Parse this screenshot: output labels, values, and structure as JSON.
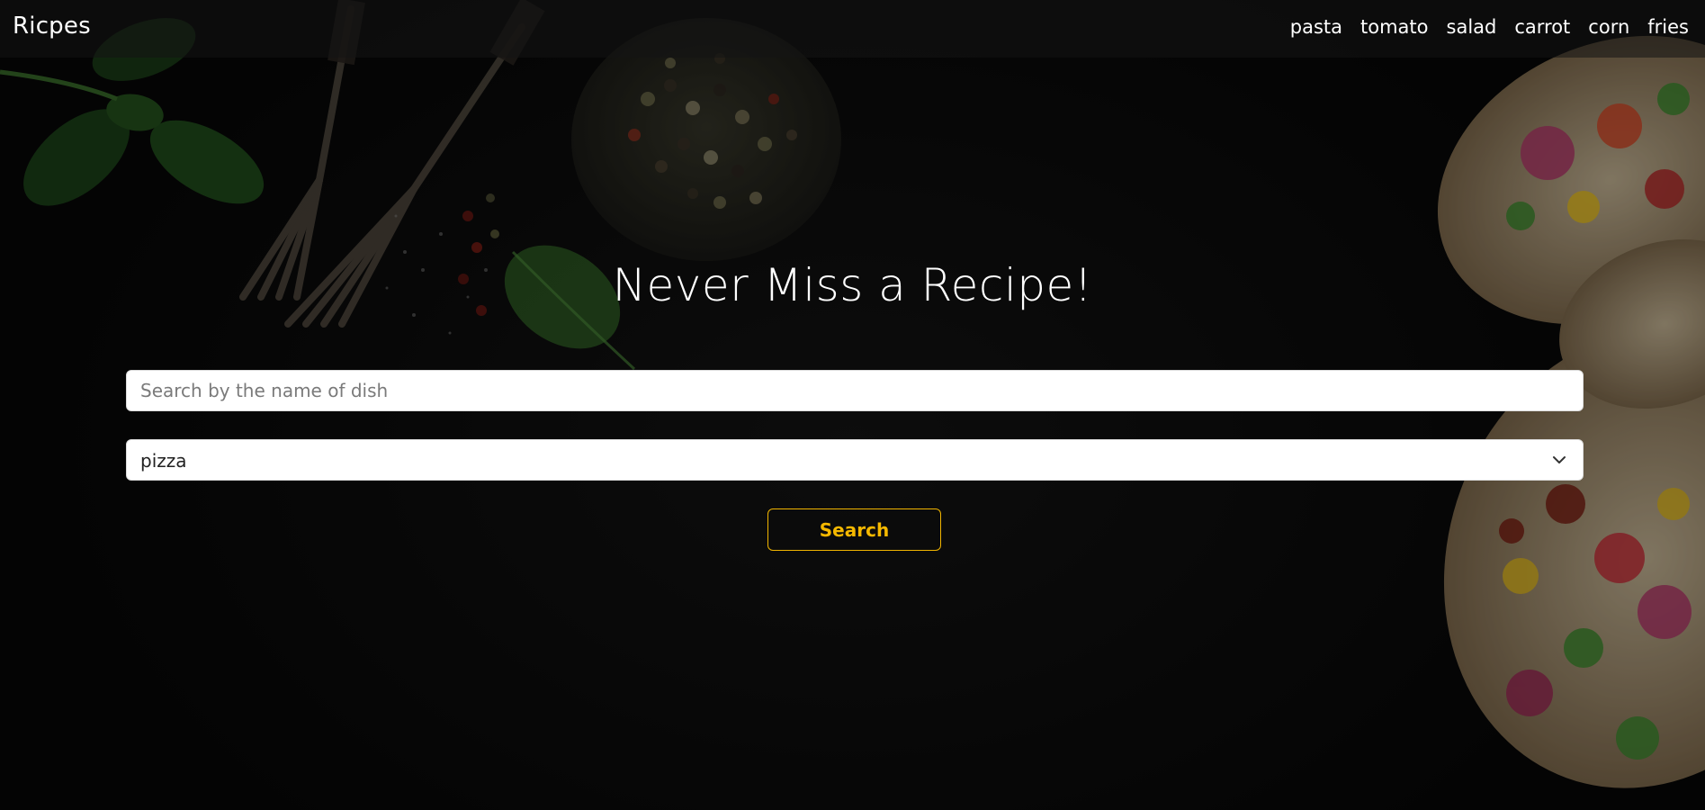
{
  "navbar": {
    "brand": "Ricpes",
    "links": [
      "pasta",
      "tomato",
      "salad",
      "carrot",
      "corn",
      "fries"
    ]
  },
  "hero": {
    "title": "Never Miss a Recipe!"
  },
  "search": {
    "placeholder": "Search by the name of dish",
    "value": ""
  },
  "category_select": {
    "selected": "pizza"
  },
  "search_button": {
    "label": "Search"
  },
  "colors": {
    "accent": "#f5b800",
    "background": "#0b0b0b",
    "text": "#ffffff"
  },
  "icons": [
    "chevron-down-icon"
  ]
}
